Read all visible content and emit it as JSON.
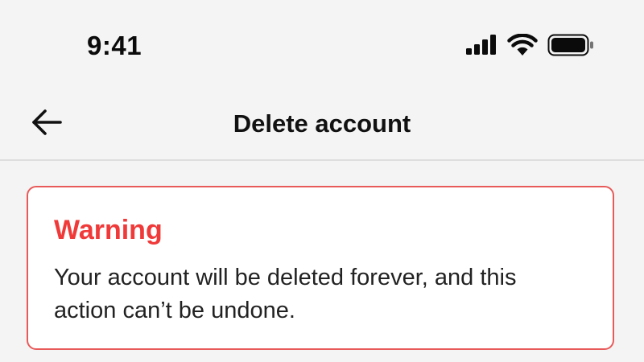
{
  "status_bar": {
    "time": "9:41",
    "icons": [
      "cellular-signal-icon",
      "wifi-icon",
      "battery-icon"
    ]
  },
  "nav": {
    "back_icon": "arrow-left-icon",
    "title": "Delete account"
  },
  "warning": {
    "title": "Warning",
    "body": "Your account will be deleted forever, and this action can’t be undone.",
    "accent_color": "#f03a3a",
    "border_color": "#e85a5a"
  }
}
